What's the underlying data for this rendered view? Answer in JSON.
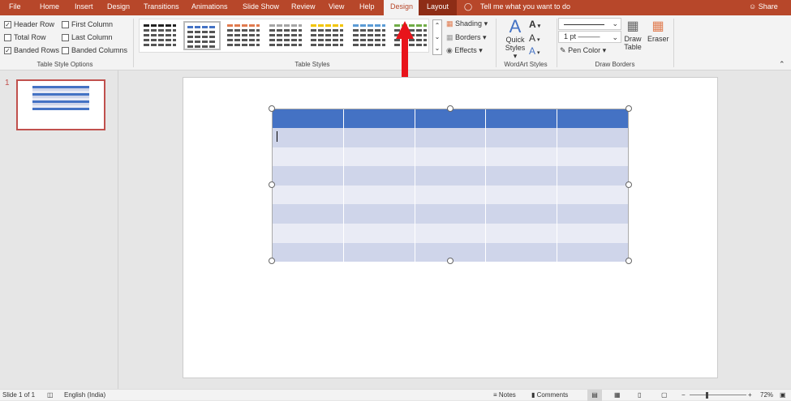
{
  "tabs": [
    "File",
    "Home",
    "Insert",
    "Design",
    "Transitions",
    "Animations",
    "Slide Show",
    "Review",
    "View",
    "Help",
    "Design",
    "Layout"
  ],
  "active_tab": "Design",
  "tell_me": "Tell me what you want to do",
  "share": "Share",
  "table_style_options": {
    "label": "Table Style Options",
    "items": [
      {
        "label": "Header Row",
        "checked": true
      },
      {
        "label": "Total Row",
        "checked": false
      },
      {
        "label": "Banded Rows",
        "checked": true
      },
      {
        "label": "First Column",
        "checked": false
      },
      {
        "label": "Last Column",
        "checked": false
      },
      {
        "label": "Banded Columns",
        "checked": false
      }
    ]
  },
  "table_styles": {
    "label": "Table Styles",
    "colors": [
      "#222222",
      "#4472c4",
      "#e07b4f",
      "#a5a5a5",
      "#f2c400",
      "#5b9bd5",
      "#70ad47"
    ],
    "selected": 1
  },
  "shading": "Shading",
  "borders": "Borders",
  "effects": "Effects",
  "wordart": {
    "label": "WordArt Styles",
    "quick_styles": "Quick",
    "quick_styles2": "Styles"
  },
  "draw_borders": {
    "label": "Draw Borders",
    "weight": "1 pt",
    "pen_color": "Pen Color",
    "draw_table": "Draw",
    "draw_table2": "Table",
    "eraser": "Eraser"
  },
  "slide_number": "1",
  "status": {
    "slide": "Slide 1 of 1",
    "language": "English (India)",
    "notes": "Notes",
    "comments": "Comments",
    "zoom": "72%"
  },
  "table": {
    "columns": 5,
    "body_rows": 7,
    "header_color": "#4472c4",
    "band_dark": "#cfd5ea",
    "band_light": "#e9ebf5"
  },
  "accent": "#b7472a"
}
